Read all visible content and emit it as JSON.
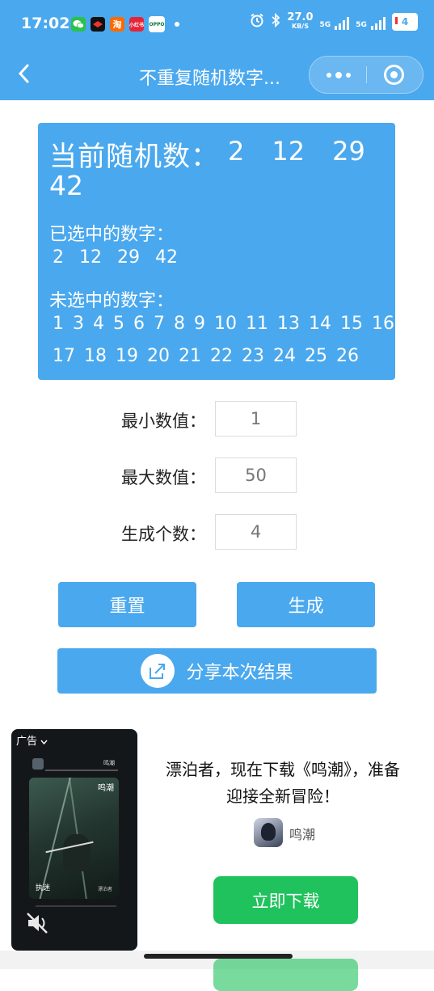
{
  "status_bar": {
    "time": "17:02",
    "app_icons": [
      "wechat-icon",
      "game-icon",
      "taobao-icon",
      "xiaohongshu-icon",
      "oppo-icon"
    ],
    "app_texts": [
      "",
      "",
      "淘",
      "小红书",
      "OPPO"
    ],
    "net_speed": "27.0",
    "net_unit": "KB/S",
    "sim1": "5G",
    "sim2": "5G",
    "battery": "4"
  },
  "nav": {
    "title": "不重复随机数字..."
  },
  "result": {
    "current_label": "当前随机数：",
    "current_numbers": [
      "2",
      "12",
      "29",
      "42"
    ],
    "selected_label": "已选中的数字：",
    "selected_numbers": [
      "2",
      "12",
      "29",
      "42"
    ],
    "unselected_label": "未选中的数字：",
    "unselected_numbers": [
      "1",
      "3",
      "4",
      "5",
      "6",
      "7",
      "8",
      "9",
      "10",
      "11",
      "13",
      "14",
      "15",
      "16",
      "17",
      "18",
      "19",
      "20",
      "21",
      "22",
      "23",
      "24",
      "25",
      "26"
    ]
  },
  "form": {
    "min_label": "最小数值：",
    "min_value": "1",
    "max_label": "最大数值：",
    "max_value": "50",
    "count_label": "生成个数：",
    "count_value": "4"
  },
  "buttons": {
    "reset": "重置",
    "generate": "生成",
    "share": "分享本次结果"
  },
  "ad": {
    "tag": "广告",
    "video_brand": "鸣潮",
    "video_title": "鸣潮",
    "video_caption_left": "执迷",
    "video_caption_right": "漂泊者",
    "headline": "漂泊者，现在下载《鸣潮》，准备迎接全新冒险！",
    "brand_name": "鸣潮",
    "download_button": "立即下载"
  },
  "colors": {
    "primary": "#4aa8ee",
    "ad_button": "#1fc25c"
  }
}
